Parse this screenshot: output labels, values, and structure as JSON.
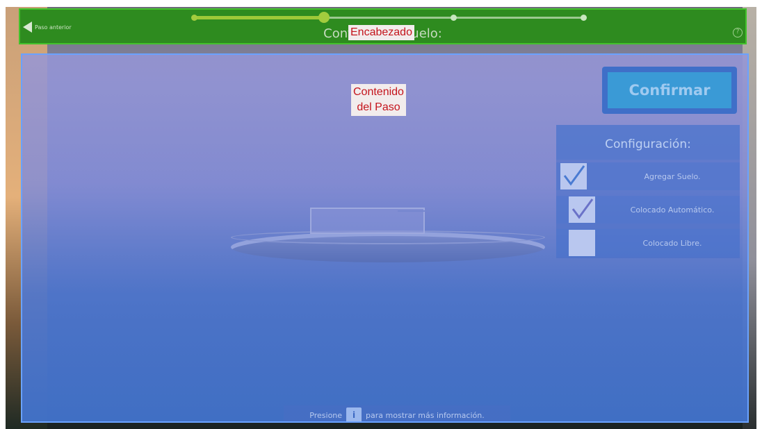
{
  "header": {
    "back_label": "Paso anterior",
    "title": "Configure el Suelo:",
    "overlay_label": "Encabezado",
    "progress_steps": 4,
    "progress_current_step": 2
  },
  "content": {
    "overlay_label_line1": "Contenido",
    "overlay_label_line2": "del Paso",
    "confirm_label": "Confirmar",
    "config": {
      "title": "Configuración:",
      "options": [
        {
          "label": "Agregar Suelo.",
          "checked": true
        },
        {
          "label": "Colocado Automático.",
          "checked": true
        },
        {
          "label": "Colocado Libre.",
          "checked": false
        }
      ]
    },
    "info": {
      "prefix": "Presione",
      "key": "i",
      "suffix": "para mostrar más información."
    }
  },
  "colors": {
    "header_green": "#2e8b1f",
    "header_border": "#43c22c",
    "content_border": "#6aa2ff",
    "overlay_text": "#c4141c",
    "confirm_button": "#3a9ad6"
  },
  "icons": {
    "back": "left-triangle-arrow",
    "help": "question-mark-circle",
    "checkbox_checked": "check-mark"
  }
}
